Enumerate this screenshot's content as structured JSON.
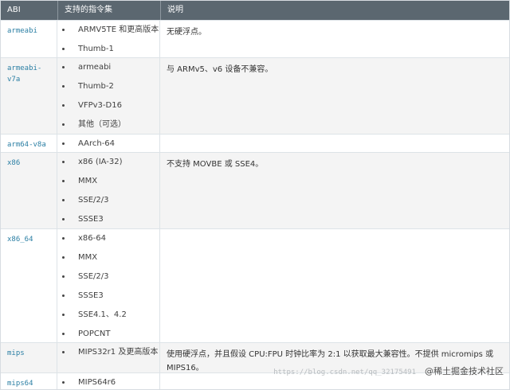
{
  "table": {
    "headers": [
      "ABI",
      "支持的指令集",
      "说明"
    ],
    "rows": [
      {
        "abi": "armeabi",
        "instructions": [
          "ARMV5TE 和更高版本",
          "Thumb-1"
        ],
        "description": "无硬浮点。"
      },
      {
        "abi": "armeabi-v7a",
        "instructions": [
          "armeabi",
          "Thumb-2",
          "VFPv3-D16",
          "其他（可选）"
        ],
        "description": "与 ARMv5、v6 设备不兼容。"
      },
      {
        "abi": "arm64-v8a",
        "instructions": [
          "AArch-64"
        ],
        "description": ""
      },
      {
        "abi": "x86",
        "instructions": [
          "x86 (IA-32)",
          "MMX",
          "SSE/2/3",
          "SSSE3"
        ],
        "description": "不支持 MOVBE 或 SSE4。"
      },
      {
        "abi": "x86_64",
        "instructions": [
          "x86-64",
          "MMX",
          "SSE/2/3",
          "SSSE3",
          "SSE4.1、4.2",
          "POPCNT"
        ],
        "description": ""
      },
      {
        "abi": "mips",
        "instructions": [
          "MIPS32r1 及更高版本"
        ],
        "description": "使用硬浮点，并且假设 CPU:FPU 时钟比率为 2:1 以获取最大兼容性。不提供 micromips 或 MIPS16。"
      },
      {
        "abi": "mips64",
        "instructions": [
          "MIPS64r6"
        ],
        "description": ""
      }
    ]
  },
  "watermark": {
    "text": "@稀土掘金技术社区",
    "url": "https://blog.csdn.net/qq_32175491"
  }
}
